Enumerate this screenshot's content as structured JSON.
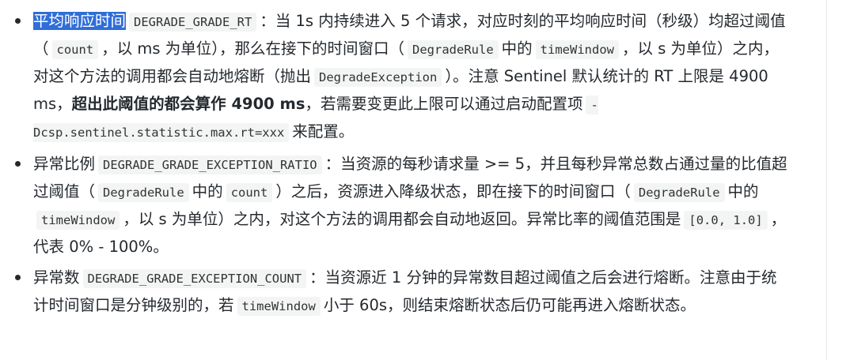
{
  "items": [
    {
      "highlight": "平均响应时间",
      "code1": "DEGRADE_GRADE_RT",
      "t1": "：当 1s 内持续进入 5 个请求，对应时刻的平均响应时间（秒级）均超过阈值（",
      "code2": "count",
      "t2": "，以 ms 为单位），那么在接下的时间窗口（",
      "code3": "DegradeRule",
      "t3": "中的",
      "code4": "timeWindow",
      "t4": "，以 s 为单位）之内，对这个方法的调用都会自动地熔断（抛出",
      "code5": "DegradeException",
      "t5": "）。注意 Sentinel 默认统计的 RT 上限是 4900 ms，",
      "bold": "超出此阈值的都会算作 4900 ms",
      "t6": "，若需要变更此上限可以通过启动配置项",
      "code6": "-Dcsp.sentinel.statistic.max.rt=xxx",
      "t7": "来配置。"
    },
    {
      "label": "异常比例",
      "code1": "DEGRADE_GRADE_EXCEPTION_RATIO",
      "t1": "：当资源的每秒请求量 >= 5，并且每秒异常总数占通过量的比值超过阈值（",
      "code2": "DegradeRule",
      "t2": "中的",
      "code3": "count",
      "t3": "）之后，资源进入降级状态，即在接下的时间窗口（",
      "code4": "DegradeRule",
      "t4": "中的",
      "code5": "timeWindow",
      "t5": "，以 s 为单位）之内，对这个方法的调用都会自动地返回。异常比率的阈值范围是",
      "code6": "[0.0, 1.0]",
      "t6": "，代表 0% - 100%。"
    },
    {
      "label": "异常数",
      "code1": "DEGRADE_GRADE_EXCEPTION_COUNT",
      "t1": "：当资源近 1 分钟的异常数目超过阈值之后会进行熔断。注意由于统计时间窗口是分钟级别的，若",
      "code2": "timeWindow",
      "t2": "小于 60s，则结束熔断状态后仍可能再进入熔断状态。"
    }
  ]
}
